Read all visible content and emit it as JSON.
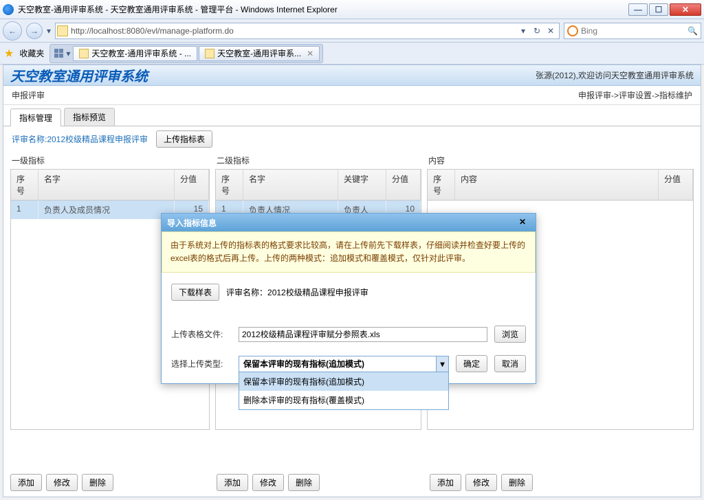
{
  "window": {
    "title": "天空教室-通用评审系统 - 天空教室通用评审系统 - 管理平台 - Windows Internet Explorer"
  },
  "nav": {
    "url": "http://localhost:8080/evl/manage-platform.do",
    "search_placeholder": "Bing"
  },
  "favbar": {
    "label": "收藏夹"
  },
  "tabs": [
    {
      "label": "天空教室-通用评审系统 - ...",
      "active": true
    },
    {
      "label": "天空教室-通用评审系...",
      "active": false
    }
  ],
  "banner": {
    "sysname": "天空教室通用评审系统",
    "welcome": "张源(2012),欢迎访问天空教室通用评审系统"
  },
  "crumb": {
    "left": "申报评审",
    "right": "申报评审->评审设置->指标维护"
  },
  "subtabs": {
    "manage": "指标管理",
    "preview": "指标预览"
  },
  "toolbar": {
    "eval_name": "评审名称:2012校级精品课程申报评审",
    "upload": "上传指标表"
  },
  "panels": {
    "p1": {
      "title": "一级指标",
      "cols": {
        "no": "序号",
        "name": "名字",
        "val": "分值"
      },
      "row": {
        "no": "1",
        "name": "负责人及成员情况",
        "val": "15"
      }
    },
    "p2": {
      "title": "二级指标",
      "cols": {
        "no": "序号",
        "name": "名字",
        "kw": "关键字",
        "val": "分值"
      },
      "row": {
        "no": "1",
        "name": "负责人情况",
        "kw": "负责人",
        "val": "10"
      }
    },
    "p3": {
      "title": "内容",
      "cols": {
        "no": "序号",
        "name": "内容",
        "val": "分值"
      }
    }
  },
  "btns": {
    "add": "添加",
    "edit": "修改",
    "del": "删除"
  },
  "modal": {
    "title": "导入指标信息",
    "notice": "由于系统对上传的指标表的格式要求比较高，请在上传前先下载样表，仔细阅读并检查好要上传的excel表的格式后再上传。上传的两种模式：追加模式和覆盖模式，仅针对此评审。",
    "download": "下载样表",
    "eval_label": "评审名称：",
    "eval_value": "2012校级精品课程申报评审",
    "file_label": "上传表格文件:",
    "file_value": "2012校级精品课程评审赋分参照表.xls",
    "browse": "浏览",
    "type_label": "选择上传类型:",
    "sel_value": "保留本评审的现有指标(追加模式)",
    "opts": [
      "保留本评审的现有指标(追加模式)",
      "删除本评审的现有指标(覆盖模式)"
    ],
    "ok": "确定",
    "cancel": "取消"
  }
}
